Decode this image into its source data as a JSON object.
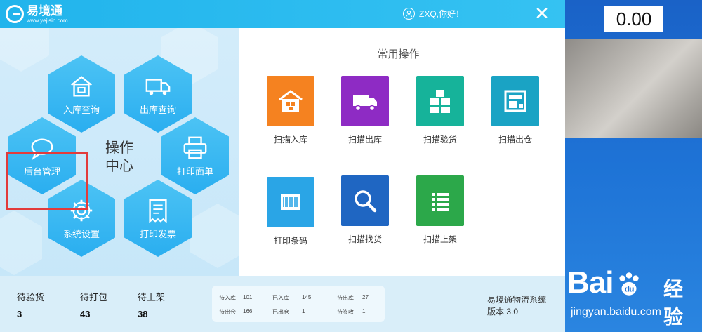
{
  "window": {
    "logo_text": "易境通",
    "logo_url": "www.yejisin.com",
    "user_greeting": "ZXQ,你好！",
    "close_label": "✕"
  },
  "operation_center": {
    "label_line1": "操作",
    "label_line2": "中心",
    "items": [
      {
        "label": "入库查询",
        "icon": "warehouse-icon"
      },
      {
        "label": "出库查询",
        "icon": "truck-icon"
      },
      {
        "label": "后台管理",
        "icon": "chat-bubble-icon"
      },
      {
        "label": "打印面单",
        "icon": "printer-icon"
      },
      {
        "label": "系统设置",
        "icon": "gear-icon"
      },
      {
        "label": "打印发票",
        "icon": "invoice-icon"
      }
    ]
  },
  "common_ops": {
    "title": "常用操作",
    "items": [
      {
        "label": "扫描入库",
        "icon": "warehouse-icon",
        "color": "#f58220"
      },
      {
        "label": "扫描出库",
        "icon": "truck-icon",
        "color": "#8e2bc4"
      },
      {
        "label": "扫描验货",
        "icon": "boxes-icon",
        "color": "#16b39a"
      },
      {
        "label": "扫描出仓",
        "icon": "shelf-box-icon",
        "color": "#1aa3c4"
      },
      {
        "label": "打印条码",
        "icon": "barcode-icon",
        "color": "#2aa5e6"
      },
      {
        "label": "扫描找货",
        "icon": "magnifier-icon",
        "color": "#1f66c2"
      },
      {
        "label": "扫描上架",
        "icon": "list-icon",
        "color": "#2ca84a"
      }
    ]
  },
  "status": {
    "stats": [
      {
        "label": "待验货",
        "value": "3"
      },
      {
        "label": "待打包",
        "value": "43"
      },
      {
        "label": "待上架",
        "value": "38"
      }
    ],
    "mini": [
      {
        "label": "待入库",
        "value": "101"
      },
      {
        "label": "已入库",
        "value": "145"
      },
      {
        "label": "待出库",
        "value": "27"
      },
      {
        "label": "待出仓",
        "value": "166"
      },
      {
        "label": "已出仓",
        "value": "1"
      },
      {
        "label": "待签收",
        "value": "1"
      }
    ],
    "system_name": "易境通物流系统",
    "version": "版本 3.0"
  },
  "desktop": {
    "counter": "0.00",
    "watermark_text": "Bai  经验",
    "watermark_url": "jingyan.baidu.com"
  }
}
